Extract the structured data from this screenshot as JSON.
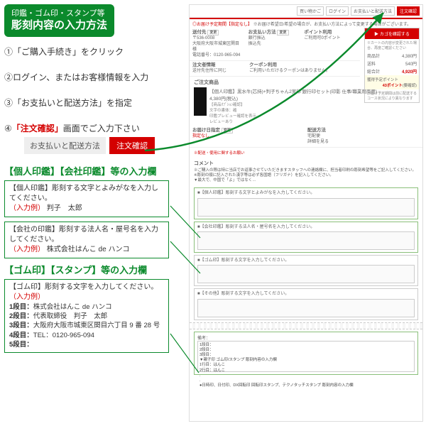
{
  "header": {
    "small": "印鑑・ゴム印・スタンプ等",
    "big": "彫刻内容の入力方法"
  },
  "steps": {
    "s1": "①「ご購入手続き」をクリック",
    "s2": "②ログイン、またはお客様情報を入力",
    "s3": "③「お支払いと配送方法」を指定",
    "s4_pre": "④",
    "s4_red": "「注文確認」",
    "s4_post": "画面でご入力下さい"
  },
  "tabs": {
    "gray": "お支払いと配送方法",
    "red": "注文確認"
  },
  "sec1_title": "【個人印鑑】【会社印鑑】等の入力欄",
  "box1": {
    "lbl": "【個人印鑑】彫刻する文字とよみがなを入力してください。",
    "ex_lbl": "（入力例）",
    "ex_val": "判子　太郎"
  },
  "box2": {
    "lbl": "【会社の印鑑】彫刻する法人名・屋号名を入力してください。",
    "ex_lbl": "（入力例）",
    "ex_val": "株式会社はんこ de ハンコ"
  },
  "sec2_title": "【ゴム印】【スタンプ】等の入力欄",
  "box3": {
    "lbl": "【ゴム印】彫刻する文字を入力してください。",
    "ex_lbl": "（入力例）",
    "l1_k": "1段目：",
    "l1_v": "株式会社はんこ de ハンコ",
    "l2_k": "2段目：",
    "l2_v": "代表取締役　判子　太郎",
    "l3_k": "3段目：",
    "l3_v": "大阪府大阪市城東区関目六丁目 9 番 28 号",
    "l4_k": "4段目：",
    "l4_v": "TEL：0120-965-094",
    "l5_k": "5段目："
  },
  "mock": {
    "top": {
      "t1": "買い物かご",
      "t2": "ログイン",
      "t3": "お支払いと配送方法",
      "t4": "注文確認"
    },
    "notice_pre": "◎お届け予定期間",
    "notice_red": "【指定なし】",
    "notice_post": "※お届け希望日/希望の場合が、お支払い方法によって変更する場合がございます。",
    "c1_h": "送付先",
    "c1_chg": "変更",
    "c1_b": "〒536-0008\n大阪府大阪市城東区関目\n様\n電話番号：0120-965-094",
    "c2_h": "お支払い方法",
    "c2_chg": "変更",
    "c2_b": "銀行振込\n振込先",
    "c3_h": "ポイント利用",
    "c3_b": "ご利用可0ポイント",
    "r1_h": "注文者情報",
    "r1_b": "送付先住所に同じ",
    "r2_h": "クーポン利用",
    "r2_b": "ご利用いただけるクーポンはありません。",
    "side": {
      "btn": "▶ カゴを確認する",
      "note": "※カートの内容が変更された場合、再度ご確認ください",
      "goods": "商品計",
      "goods_v": "4,380円",
      "ship": "送料",
      "ship_v": "540円",
      "total": "総合計",
      "total_v": "4,920円",
      "pts_h": "獲得予定ポイント",
      "pts_v": "43ポイント",
      "pts_note": "(要確認)",
      "note2": "お届け予定期間は前に配送するコース状況により異なります"
    },
    "prod_h": "ご注文商品",
    "prod_title": "【個人印鑑】黒水牛(芯持)+判子ちゃん2実印 銀行印セット(印影 仕事/職業用両用)",
    "prod_price": "4,380円(税込)",
    "prod_opt": "【商品ｵﾌﾟｼｮﾝ確認】\n文字の書体：確\n印鑑プレビュー確認を表示\nレビューあり",
    "ship_cols": {
      "d_h": "お届け日指定",
      "d_chg": "変更",
      "d_b": "指定なし",
      "m_h": "配送方法",
      "m_b": "宅配便\n詳細を見る"
    },
    "free_h": "※配送・使用に関するお願い",
    "comment_h": "コメント",
    "comment_note": "※ご購入の際は特に当店でお返事させていただきますスタッフへの連絡欄に、担当者印刷の彫刻希望等をご記入してください。\n※彫刻の順に記入された漢字等は必ず各国語（フリガナ）を記入してください。\n▼最大で、中国で「よ」ではなく…",
    "gb1": "■【個人印鑑】彫刻する文字とよみがなを入力してください。",
    "gb2": "■【会社印鑑】彫刻する法人名・屋号名を入力してください。",
    "gb3": "■【ゴム印】彫刻する文字を入力してください。",
    "gb4": "■【その他】彫刻する文字を入力してください。",
    "biko_h": "備考：",
    "biko_lines": "1段目：\n2段目：\n3段目：\n▼親子印 ゴム印/スタンプ 彫刻内容の入力欄\n1行目：はんこ\n2行目：はんこ\n.\n.\n●日時印、日付印、DX回転印 回転印スタンプ、テクノタッチスタンプ 彫刻内容の入力欄"
  }
}
